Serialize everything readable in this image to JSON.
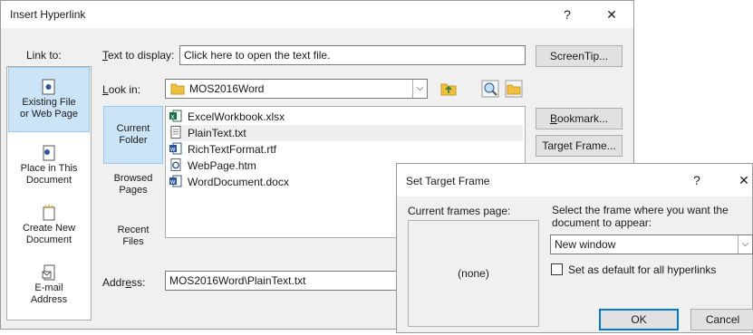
{
  "insert_dialog": {
    "title": "Insert Hyperlink",
    "help": "?",
    "close": "✕",
    "link_to_label": "Link to:",
    "text_to_display_label": "Text to display:",
    "text_to_display_value": "Click here to open the text file.",
    "screentip_label": "ScreenTip...",
    "look_in_label": "Look in:",
    "look_in_value": "MOS2016Word",
    "bookmark_label": "Bookmark...",
    "target_frame_label": "Target Frame...",
    "address_label": "Address:",
    "address_value": "MOS2016Word\\PlainText.txt",
    "link_targets": [
      {
        "line1": "Existing File",
        "line2": "or Web Page",
        "selected": true
      },
      {
        "line1": "Place in This",
        "line2": "Document",
        "selected": false
      },
      {
        "line1": "Create New",
        "line2": "Document",
        "selected": false
      },
      {
        "line1": "E-mail",
        "line2": "Address",
        "selected": false
      }
    ],
    "side_tabs": [
      {
        "line1": "Current",
        "line2": "Folder",
        "selected": true
      },
      {
        "line1": "Browsed",
        "line2": "Pages",
        "selected": false
      },
      {
        "line1": "Recent",
        "line2": "Files",
        "selected": false
      }
    ],
    "files": [
      {
        "name": "ExcelWorkbook.xlsx",
        "icon": "excel-file-icon",
        "selected": false
      },
      {
        "name": "PlainText.txt",
        "icon": "text-file-icon",
        "selected": true
      },
      {
        "name": "RichTextFormat.rtf",
        "icon": "word-file-icon",
        "selected": false
      },
      {
        "name": "WebPage.htm",
        "icon": "web-page-icon",
        "selected": false
      },
      {
        "name": "WordDocument.docx",
        "icon": "word-file-icon",
        "selected": false
      }
    ]
  },
  "target_dialog": {
    "title": "Set Target Frame",
    "help": "?",
    "close": "✕",
    "current_frames_label": "Current frames page:",
    "frames_preview_value": "(none)",
    "select_frame_line1": "Select the frame where you want the",
    "select_frame_line2": "document to appear:",
    "frame_value": "New window",
    "default_checkbox_label": "Set as default for all hyperlinks",
    "ok_label": "OK",
    "cancel_label": "Cancel"
  },
  "colors": {
    "selection": "#cce4f7",
    "accent": "#0078d7",
    "dialog_bg": "#f0f0f0",
    "folder": "#f0c040",
    "excel": "#1d7044",
    "word": "#2b579a"
  }
}
